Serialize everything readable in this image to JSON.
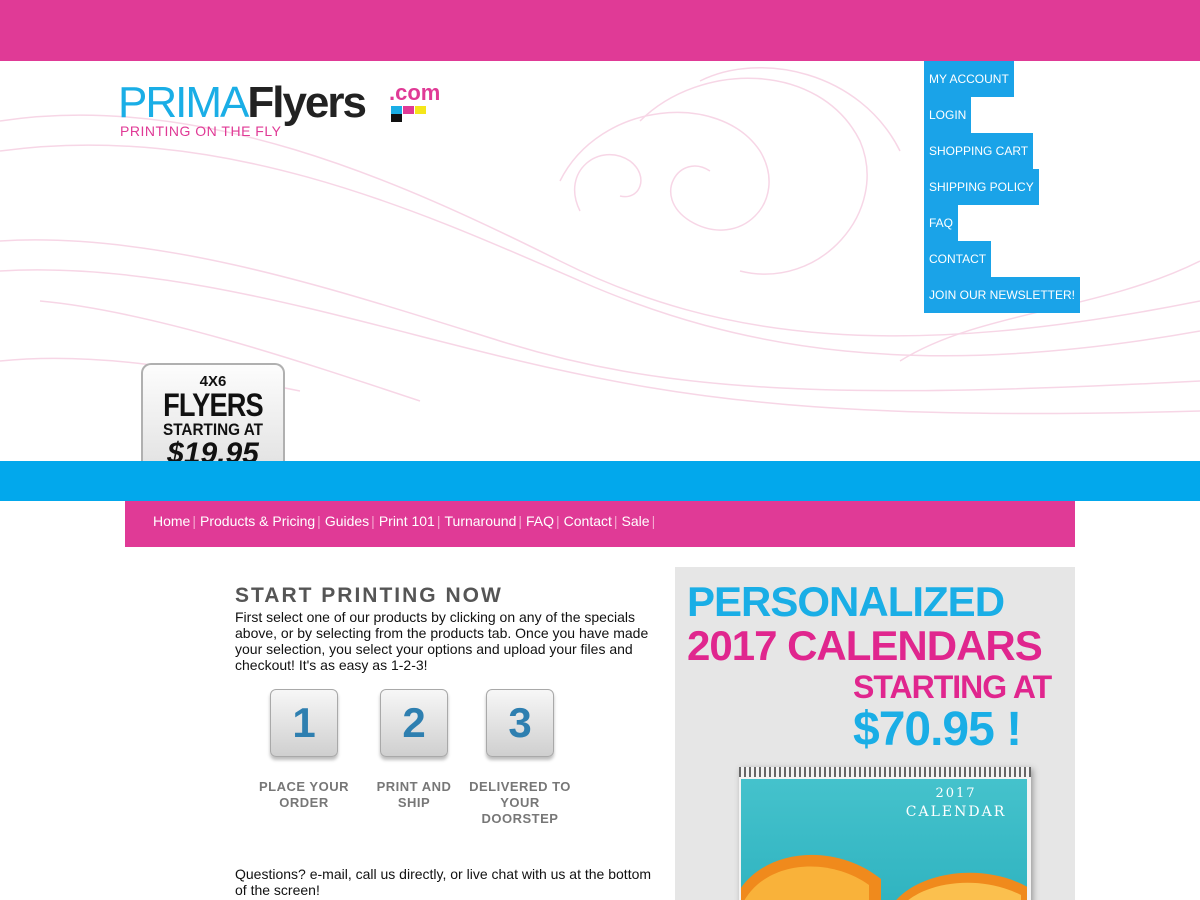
{
  "brand": {
    "name_part1": "PRIMA",
    "name_part2": "Flyers",
    "name_suffix": ".com",
    "tagline": "PRINTING ON THE FLY",
    "colors": {
      "pink": "#e03a96",
      "blue": "#02a8ec",
      "cmyk": [
        "#1aaee6",
        "#e03a96",
        "#f5e61a",
        "#111111"
      ]
    }
  },
  "account_nav": {
    "items": [
      {
        "label": "MY ACCOUNT"
      },
      {
        "label": "LOGIN"
      },
      {
        "label": "SHOPPING CART"
      },
      {
        "label": "SHIPPING POLICY"
      },
      {
        "label": "FAQ"
      },
      {
        "label": "CONTACT"
      },
      {
        "label": "JOIN OUR NEWSLETTER!"
      }
    ]
  },
  "promo_badge": {
    "line1": "4X6",
    "line2": "FLYERS",
    "line3": "STARTING AT",
    "line4": "$19.95"
  },
  "main_nav": {
    "items": [
      {
        "label": "Home"
      },
      {
        "label": "Products & Pricing"
      },
      {
        "label": "Guides"
      },
      {
        "label": "Print 101"
      },
      {
        "label": "Turnaround"
      },
      {
        "label": "FAQ"
      },
      {
        "label": "Contact"
      },
      {
        "label": "Sale"
      }
    ],
    "separator": "|"
  },
  "content": {
    "title": "START PRINTING NOW",
    "intro": "First select one of our products by clicking on any of the specials above, or by selecting from the products tab. Once you have made your selection, you select your options and upload your files and checkout! It's as easy as 1-2-3!",
    "steps": [
      {
        "number": "1",
        "label_line1": "PLACE YOUR",
        "label_line2": "ORDER"
      },
      {
        "number": "2",
        "label_line1": "PRINT AND",
        "label_line2": "SHIP"
      },
      {
        "number": "3",
        "label_line1": "DELIVERED TO",
        "label_line2": "YOUR DOORSTEP"
      }
    ],
    "questions": "Questions? e-mail, call us directly, or live chat with us at the bottom of the screen!"
  },
  "side_promo": {
    "line1": "PERSONALIZED",
    "line2": "2017 CALENDARS",
    "line3": "STARTING AT",
    "line4": "$70.95 !",
    "calendar_year": "2017",
    "calendar_word": "CALENDAR"
  }
}
